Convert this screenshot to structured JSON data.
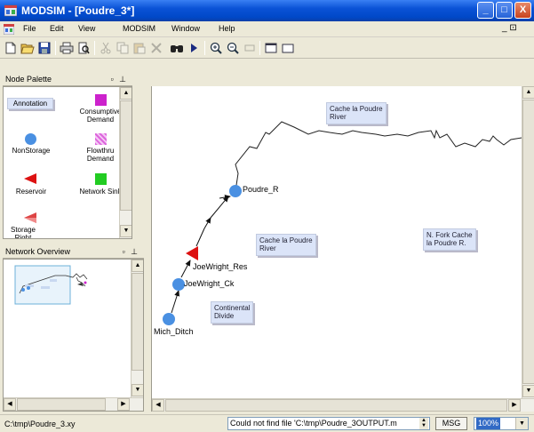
{
  "window": {
    "title": "MODSIM - [Poudre_3*]",
    "min_label": "_",
    "max_label": "□",
    "close_label": "X"
  },
  "menu": {
    "items": [
      "File",
      "Edit",
      "View",
      "MODSIM",
      "Window",
      "Help"
    ],
    "restore_label": "_  ⊡"
  },
  "toolbar": {
    "buttons": [
      "new-icon",
      "open-icon",
      "save-icon",
      "print-icon",
      "print-preview-icon",
      "cut-icon",
      "copy-icon",
      "paste-icon",
      "delete-icon",
      "find-icon",
      "run-icon",
      "zoom-in-icon",
      "zoom-out-icon",
      "undo-icon",
      "view-icon",
      "window-icon"
    ]
  },
  "node_palette": {
    "title": "Node Palette",
    "pin": "▫ ⊥",
    "items": {
      "annotation": "Annotation",
      "consumptive_demand": "Consumptive Demand",
      "nonstorage": "NonStorage",
      "flowthru_demand": "Flowthru Demand",
      "reservoir": "Reservoir",
      "network_sink": "Network Sink",
      "storage_right": "Storage Right"
    },
    "colors": {
      "consumptive": "#cc22cc",
      "flowthru": "#dd66dd",
      "nonstorage": "#4a90e2",
      "reservoir": "#dd1111",
      "sink": "#22cc22",
      "storage_right": "#dd4444"
    }
  },
  "network_overview": {
    "title": "Network Overview",
    "pin": "▫ ⊥"
  },
  "canvas": {
    "notes": {
      "cache_river_top": [
        "Cache la Poudre",
        "River"
      ],
      "cache_river_mid": [
        "Cache la Poudre",
        "River"
      ],
      "north_fork": [
        "N. Fork Cache",
        "la Poudre R."
      ],
      "continental": [
        "Continental",
        "Divide"
      ]
    },
    "nodes": {
      "poudre_r": "Poudre_R",
      "joewright_res": "JoeWright_Res",
      "joewright_ck": "JoeWright_Ck",
      "mich_ditch": "Mich_Ditch"
    }
  },
  "status": {
    "path": "C:\\tmp\\Poudre_3.xy",
    "message": "Could not find file 'C:\\tmp\\Poudre_3OUTPUT.m",
    "msg_button": "MSG",
    "zoom": "100%"
  }
}
